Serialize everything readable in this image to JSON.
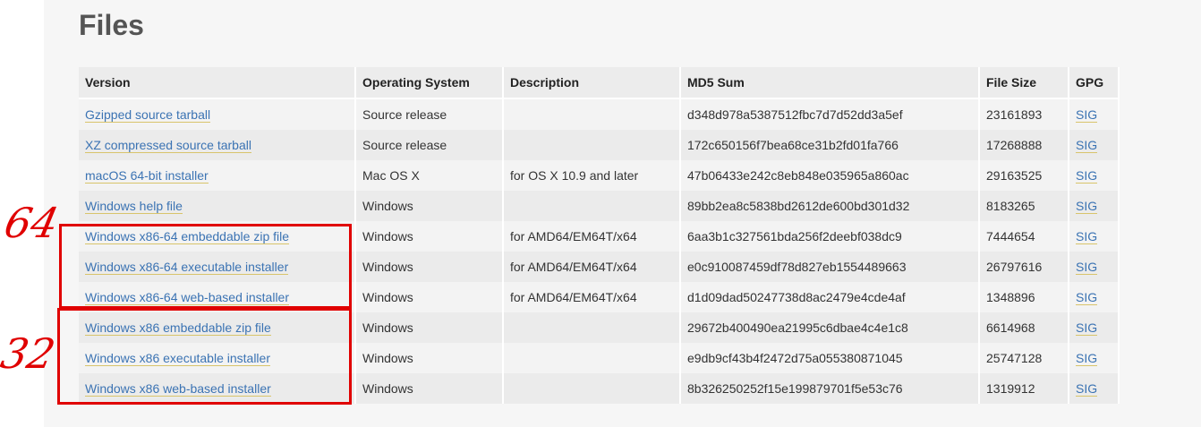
{
  "page": {
    "title": "Files"
  },
  "table": {
    "headers": [
      "Version",
      "Operating System",
      "Description",
      "MD5 Sum",
      "File Size",
      "GPG"
    ],
    "rows": [
      {
        "version": "Gzipped source tarball",
        "os": "Source release",
        "description": "",
        "md5": "d348d978a5387512fbc7d7d52dd3a5ef",
        "size": "23161893",
        "gpg": "SIG"
      },
      {
        "version": "XZ compressed source tarball",
        "os": "Source release",
        "description": "",
        "md5": "172c650156f7bea68ce31b2fd01fa766",
        "size": "17268888",
        "gpg": "SIG"
      },
      {
        "version": "macOS 64-bit installer",
        "os": "Mac OS X",
        "description": "for OS X 10.9 and later",
        "md5": "47b06433e242c8eb848e035965a860ac",
        "size": "29163525",
        "gpg": "SIG"
      },
      {
        "version": "Windows help file",
        "os": "Windows",
        "description": "",
        "md5": "89bb2ea8c5838bd2612de600bd301d32",
        "size": "8183265",
        "gpg": "SIG"
      },
      {
        "version": "Windows x86-64 embeddable zip file",
        "os": "Windows",
        "description": "for AMD64/EM64T/x64",
        "md5": "6aa3b1c327561bda256f2deebf038dc9",
        "size": "7444654",
        "gpg": "SIG"
      },
      {
        "version": "Windows x86-64 executable installer",
        "os": "Windows",
        "description": "for AMD64/EM64T/x64",
        "md5": "e0c910087459df78d827eb1554489663",
        "size": "26797616",
        "gpg": "SIG"
      },
      {
        "version": "Windows x86-64 web-based installer",
        "os": "Windows",
        "description": "for AMD64/EM64T/x64",
        "md5": "d1d09dad50247738d8ac2479e4cde4af",
        "size": "1348896",
        "gpg": "SIG"
      },
      {
        "version": "Windows x86 embeddable zip file",
        "os": "Windows",
        "description": "",
        "md5": "29672b400490ea21995c6dbae4c4e1c8",
        "size": "6614968",
        "gpg": "SIG"
      },
      {
        "version": "Windows x86 executable installer",
        "os": "Windows",
        "description": "",
        "md5": "e9db9cf43b4f2472d75a055380871045",
        "size": "25747128",
        "gpg": "SIG"
      },
      {
        "version": "Windows x86 web-based installer",
        "os": "Windows",
        "description": "",
        "md5": "8b326250252f15e199879701f5e53c76",
        "size": "1319912",
        "gpg": "SIG"
      }
    ]
  },
  "annotations": {
    "label_64": "64",
    "label_32": "32",
    "color": "#e00000"
  },
  "colors": {
    "link": "#3b73b3",
    "link_underline": "#d8c46b",
    "title": "#555555",
    "panel_background": "#f6f6f6"
  }
}
